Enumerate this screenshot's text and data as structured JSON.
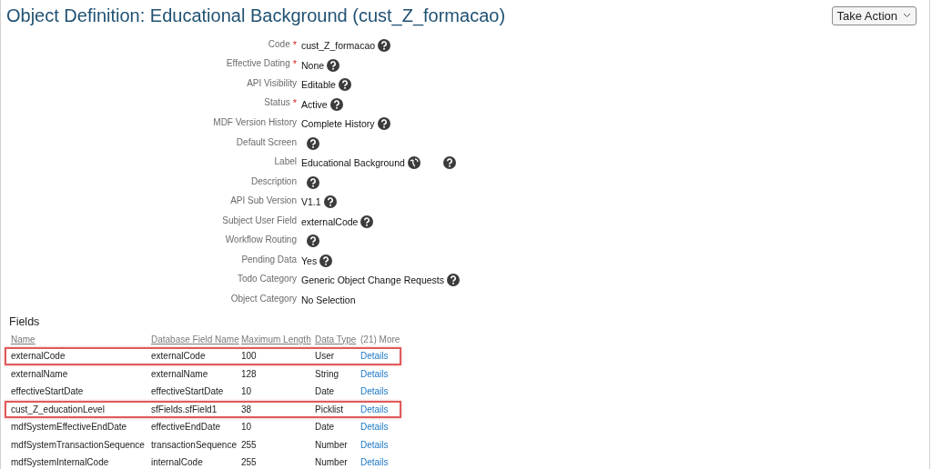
{
  "title": "Object Definition: Educational Background (cust_Z_formacao)",
  "take_action": "Take Action",
  "properties": [
    {
      "label": "Code",
      "required_mark": "*",
      "value": "cust_Z_formacao",
      "help": true,
      "translatable": false
    },
    {
      "label": "Effective Dating",
      "required_mark": "*",
      "value": "None",
      "help": true,
      "translatable": false
    },
    {
      "label": "API Visibility",
      "value": "Editable",
      "help": true,
      "translatable": false
    },
    {
      "label": "Status",
      "required_mark": "*",
      "value": "Active",
      "help": true,
      "translatable": false
    },
    {
      "label": "MDF Version History",
      "value": "Complete History",
      "help": true,
      "translatable": false
    },
    {
      "label": "Default Screen",
      "help": true,
      "translatable": false
    },
    {
      "label": "Label",
      "value": "Educational Background",
      "help": true,
      "translatable": true
    },
    {
      "label": "Description",
      "help": true,
      "translatable": false
    },
    {
      "label": "API Sub Version",
      "value": "V1.1",
      "help": true,
      "translatable": false
    },
    {
      "label": "Subject User Field",
      "value": "externalCode",
      "help": true,
      "translatable": false
    },
    {
      "label": "Workflow Routing",
      "help": true,
      "translatable": false
    },
    {
      "label": "Pending Data",
      "value": "Yes",
      "help": true,
      "translatable": false
    },
    {
      "label": "Todo Category",
      "value": "Generic Object Change Requests",
      "help": true,
      "translatable": false
    },
    {
      "label": "Object Category",
      "value": "No Selection",
      "help": false,
      "translatable": false
    }
  ],
  "fields": {
    "heading": "Fields",
    "columns": [
      "Name",
      "Database Field Name",
      "Maximum Length",
      "Data Type",
      "(21) More"
    ],
    "rows": [
      {
        "name": "externalCode",
        "db": "externalCode",
        "length": "100",
        "type": "User",
        "link": "Details",
        "highlighted": true
      },
      {
        "name": "externalName",
        "db": "externalName",
        "length": "128",
        "type": "String",
        "link": "Details",
        "highlighted": false
      },
      {
        "name": "effectiveStartDate",
        "db": "effectiveStartDate",
        "length": "10",
        "type": "Date",
        "link": "Details",
        "highlighted": false
      },
      {
        "name": "cust_Z_educationLevel",
        "db": "sfFields.sfField1",
        "length": "38",
        "type": "Picklist",
        "link": "Details",
        "highlighted": true
      },
      {
        "name": "mdfSystemEffectiveEndDate",
        "db": "effectiveEndDate",
        "length": "10",
        "type": "Date",
        "link": "Details",
        "highlighted": false
      },
      {
        "name": "mdfSystemTransactionSequence",
        "db": "transactionSequence",
        "length": "255",
        "type": "Number",
        "link": "Details",
        "highlighted": false
      },
      {
        "name": "mdfSystemInternalCode",
        "db": "internalCode",
        "length": "255",
        "type": "Number",
        "link": "Details",
        "highlighted": false
      }
    ]
  }
}
